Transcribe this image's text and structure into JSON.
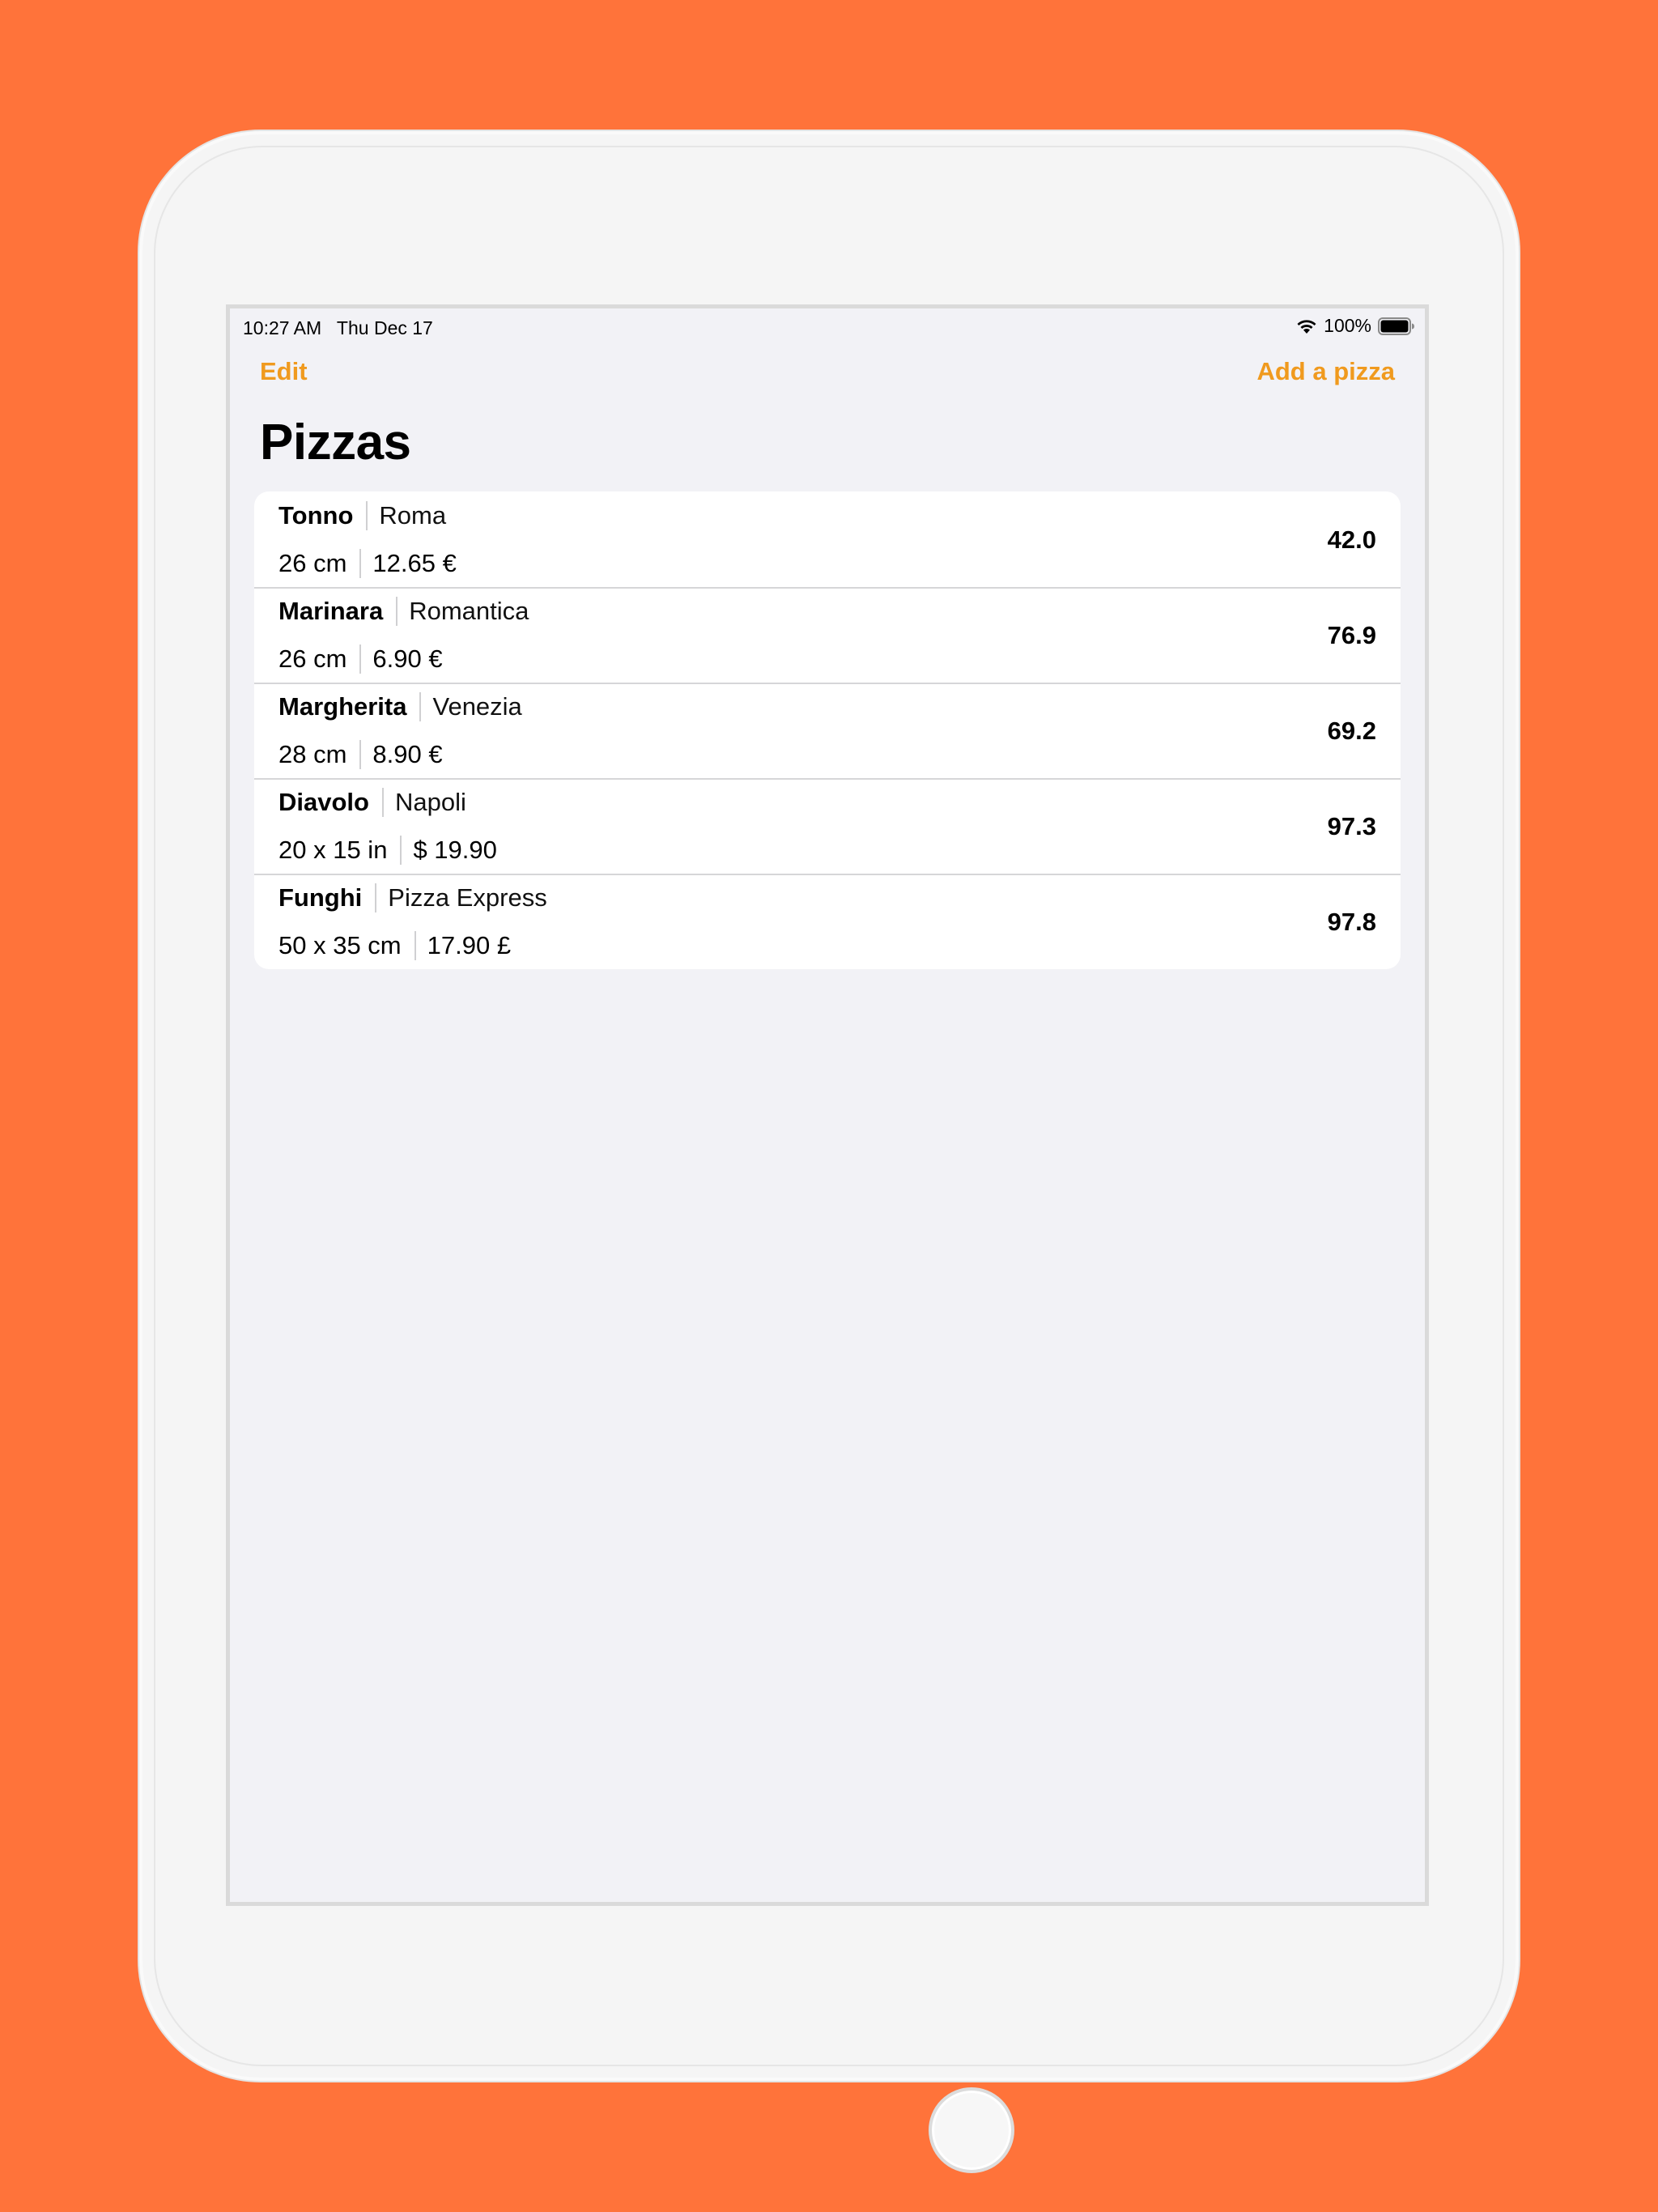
{
  "status_bar": {
    "time": "10:27 AM   Thu Dec 17",
    "battery": "100%",
    "wifi_icon": "wifi-icon",
    "battery_icon": "battery-icon"
  },
  "nav": {
    "edit_label": "Edit",
    "add_label": "Add a pizza",
    "accent_color": "#F09A1E"
  },
  "title": "Pizzas",
  "pizzas": [
    {
      "name": "Tonno",
      "place": "Roma",
      "size": "26 cm",
      "price": "12.65 €",
      "rating": "42.0"
    },
    {
      "name": "Marinara",
      "place": "Romantica",
      "size": "26 cm",
      "price": "6.90 €",
      "rating": "76.9"
    },
    {
      "name": "Margherita",
      "place": "Venezia",
      "size": "28 cm",
      "price": "8.90 €",
      "rating": "69.2"
    },
    {
      "name": "Diavolo",
      "place": "Napoli",
      "size": "20 x 15 in",
      "price": "$ 19.90",
      "rating": "97.3"
    },
    {
      "name": "Funghi",
      "place": "Pizza Express",
      "size": "50 x 35 cm",
      "price": "17.90 £",
      "rating": "97.8"
    }
  ],
  "colors": {
    "background": "#FF733A",
    "screen": "#F2F2F6"
  }
}
